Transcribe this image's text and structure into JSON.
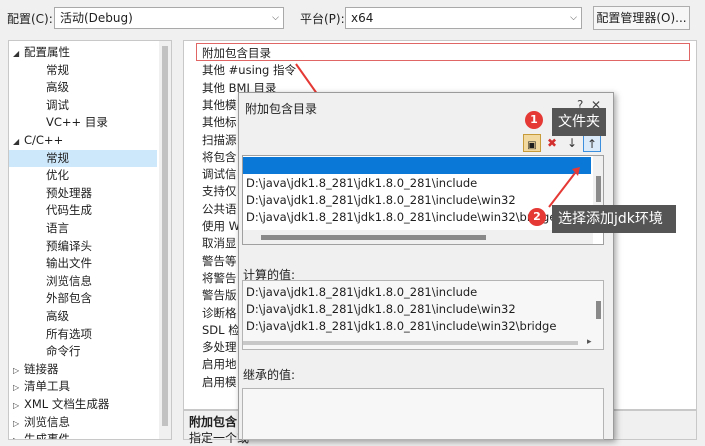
{
  "topbar": {
    "config_label": "配置(C):",
    "config_value": "活动(Debug)",
    "platform_label": "平台(P):",
    "platform_value": "x64",
    "config_manager_button": "配置管理器(O)..."
  },
  "tree": {
    "items": [
      {
        "label": "配置属性",
        "expander": "◢"
      },
      {
        "label": "常规"
      },
      {
        "label": "高级"
      },
      {
        "label": "调试"
      },
      {
        "label": "VC++ 目录"
      },
      {
        "label": "C/C++",
        "expander": "◢"
      },
      {
        "label": "常规",
        "selected": true
      },
      {
        "label": "优化"
      },
      {
        "label": "预处理器"
      },
      {
        "label": "代码生成"
      },
      {
        "label": "语言"
      },
      {
        "label": "预编译头"
      },
      {
        "label": "输出文件"
      },
      {
        "label": "浏览信息"
      },
      {
        "label": "外部包含"
      },
      {
        "label": "高级"
      },
      {
        "label": "所有选项"
      },
      {
        "label": "命令行"
      },
      {
        "label": "链接器",
        "expander": "▷"
      },
      {
        "label": "清单工具",
        "expander": "▷"
      },
      {
        "label": "XML 文档生成器",
        "expander": "▷"
      },
      {
        "label": "浏览信息",
        "expander": "▷"
      },
      {
        "label": "生成事件",
        "expander": "▷"
      }
    ]
  },
  "grid": {
    "rows": [
      "附加包含目录",
      "其他 #using 指令",
      "其他 BMI 目录",
      "其他模",
      "其他标",
      "扫描源",
      "将包含",
      "调试信",
      "支持仅",
      "公共语",
      "使用 W",
      "取消显",
      "警告等",
      "将警告",
      "警告版",
      "诊断格",
      "SDL 检",
      "多处理",
      "启用地",
      "启用模"
    ],
    "bottom_title": "附加包含目",
    "bottom_desc": "指定一个或"
  },
  "dialog": {
    "title": "附加包含目录",
    "help": "?",
    "close": "✕",
    "entries": [
      "",
      "D:\\java\\jdk1.8_281\\jdk1.8.0_281\\include",
      "D:\\java\\jdk1.8_281\\jdk1.8.0_281\\include\\win32",
      "D:\\java\\jdk1.8_281\\jdk1.8.0_281\\include\\win32\\bridge"
    ],
    "computed_label": "计算的值:",
    "computed_values": [
      "D:\\java\\jdk1.8_281\\jdk1.8.0_281\\include",
      "D:\\java\\jdk1.8_281\\jdk1.8.0_281\\include\\win32",
      "D:\\java\\jdk1.8_281\\jdk1.8.0_281\\include\\win32\\bridge"
    ],
    "inherited_label": "继承的值:"
  },
  "annotations": {
    "badge1": "1",
    "callout1": "文件夹",
    "badge2": "2",
    "callout2": "选择添加jdk环境"
  },
  "colors": {
    "selection": "#0a78d7",
    "annotation_red": "#e53935",
    "callout_bg": "#555555"
  }
}
